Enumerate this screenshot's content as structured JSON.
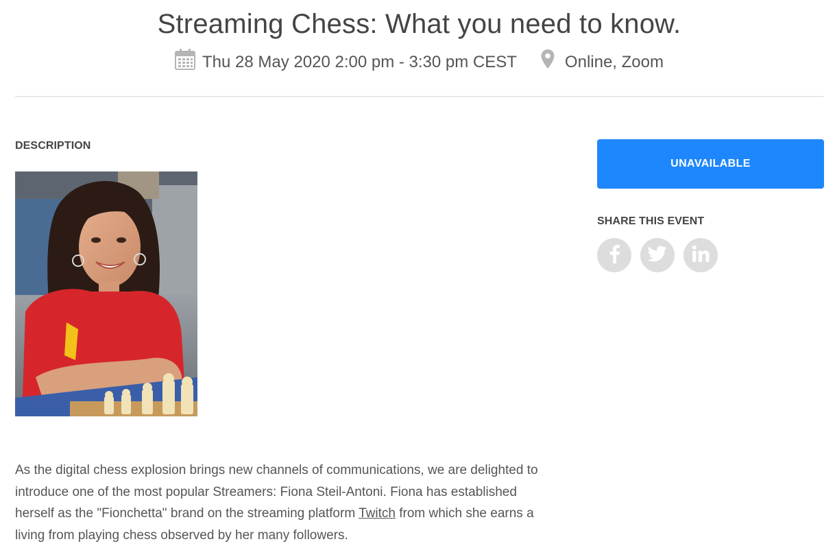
{
  "event": {
    "title": "Streaming Chess: What you need to know.",
    "datetime": "Thu 28 May 2020 2:00 pm - 3:30 pm CEST",
    "location": "Online, Zoom"
  },
  "description": {
    "label": "DESCRIPTION",
    "paragraph_before_link": "As the digital chess explosion brings new channels of communications, we are delighted to introduce one of the most popular Streamers: Fiona Steil-Antoni. Fiona has established herself as the \"Fionchetta\" brand on the streaming platform ",
    "link_text": "Twitch",
    "paragraph_after_link": " from which she earns a living from playing chess observed by her many followers."
  },
  "sidebar": {
    "status_button": "UNAVAILABLE",
    "share_label": "SHARE THIS EVENT",
    "share_buttons": [
      {
        "icon": "facebook-icon"
      },
      {
        "icon": "twitter-icon"
      },
      {
        "icon": "linkedin-icon"
      }
    ]
  },
  "colors": {
    "accent": "#1f87fd",
    "share_circle": "#dddddd",
    "text": "#444444"
  }
}
